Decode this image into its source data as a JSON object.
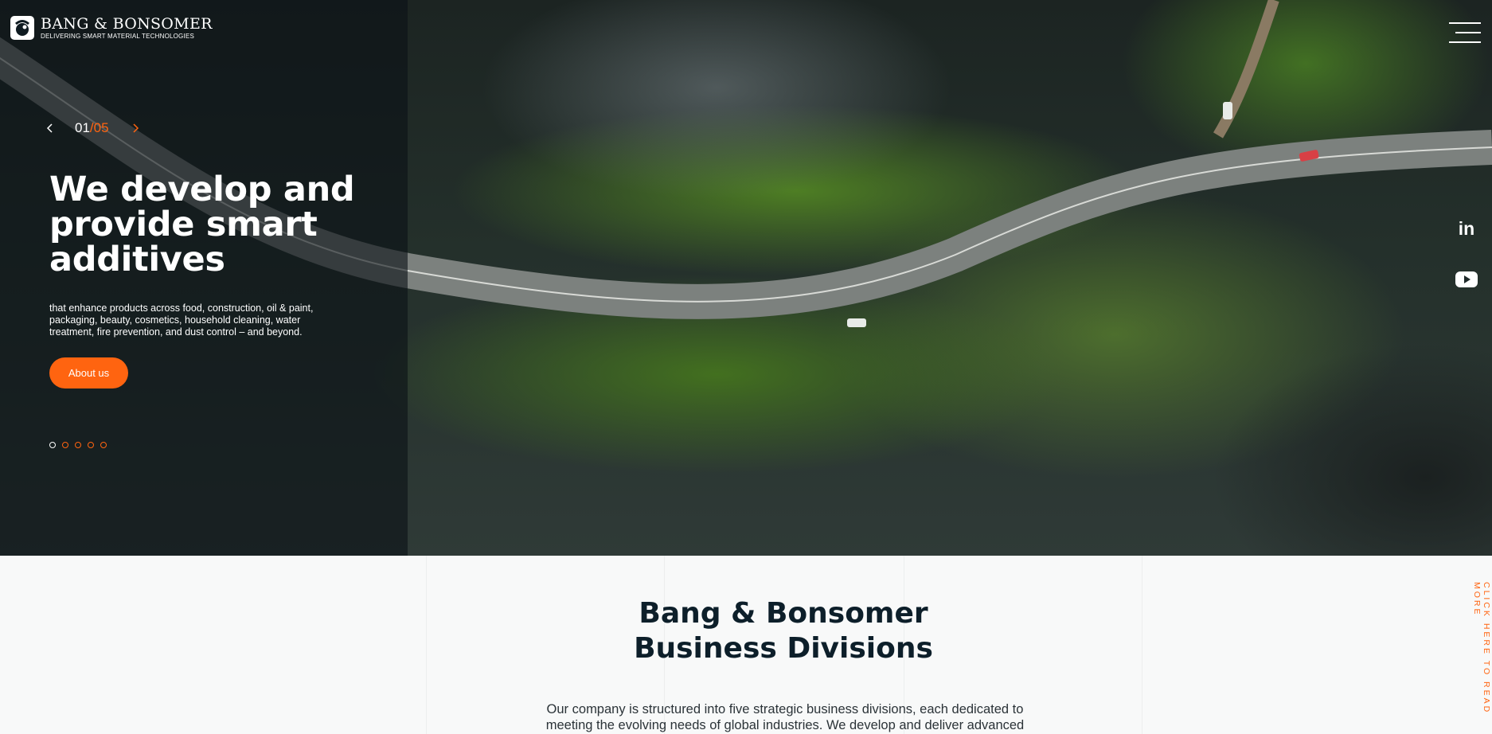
{
  "brand": {
    "name": "Bang & Bonsomer",
    "name_display": "BANG & BONSOMER",
    "tagline": "DELIVERING SMART MATERIAL TECHNOLOGIES"
  },
  "header": {
    "menu_icon": "hamburger-menu-icon"
  },
  "hero": {
    "slider": {
      "current": "01",
      "separator": "/",
      "total": "05",
      "prev_icon": "chevron-left-icon",
      "next_icon": "chevron-right-icon",
      "active_index": 0,
      "dot_count": 5
    },
    "headline": "We develop and provide smart additives",
    "subtext": "that enhance products across food, construction, oil & paint, packaging, beauty, cosmetics, household cleaning, water treatment, fire prevention, and dust control – and beyond.",
    "cta_label": "About us",
    "background": "aerial-road-through-forest-and-lake"
  },
  "social": {
    "linkedin_label": "in",
    "linkedin_icon": "linkedin-icon",
    "youtube_icon": "youtube-icon"
  },
  "divisions": {
    "title_line1": "Bang & Bonsomer",
    "title_line2": "Business Divisions",
    "intro": "Our company is structured into five strategic business divisions, each dedicated to meeting the evolving needs of global industries. We develop and deliver advanced",
    "read_more": "CLICK HERE TO READ MORE"
  },
  "colors": {
    "accent": "#ff6410",
    "dark_text": "#0d1f2a",
    "overlay": "#0c1216",
    "section_bg": "#f8f9f9"
  }
}
